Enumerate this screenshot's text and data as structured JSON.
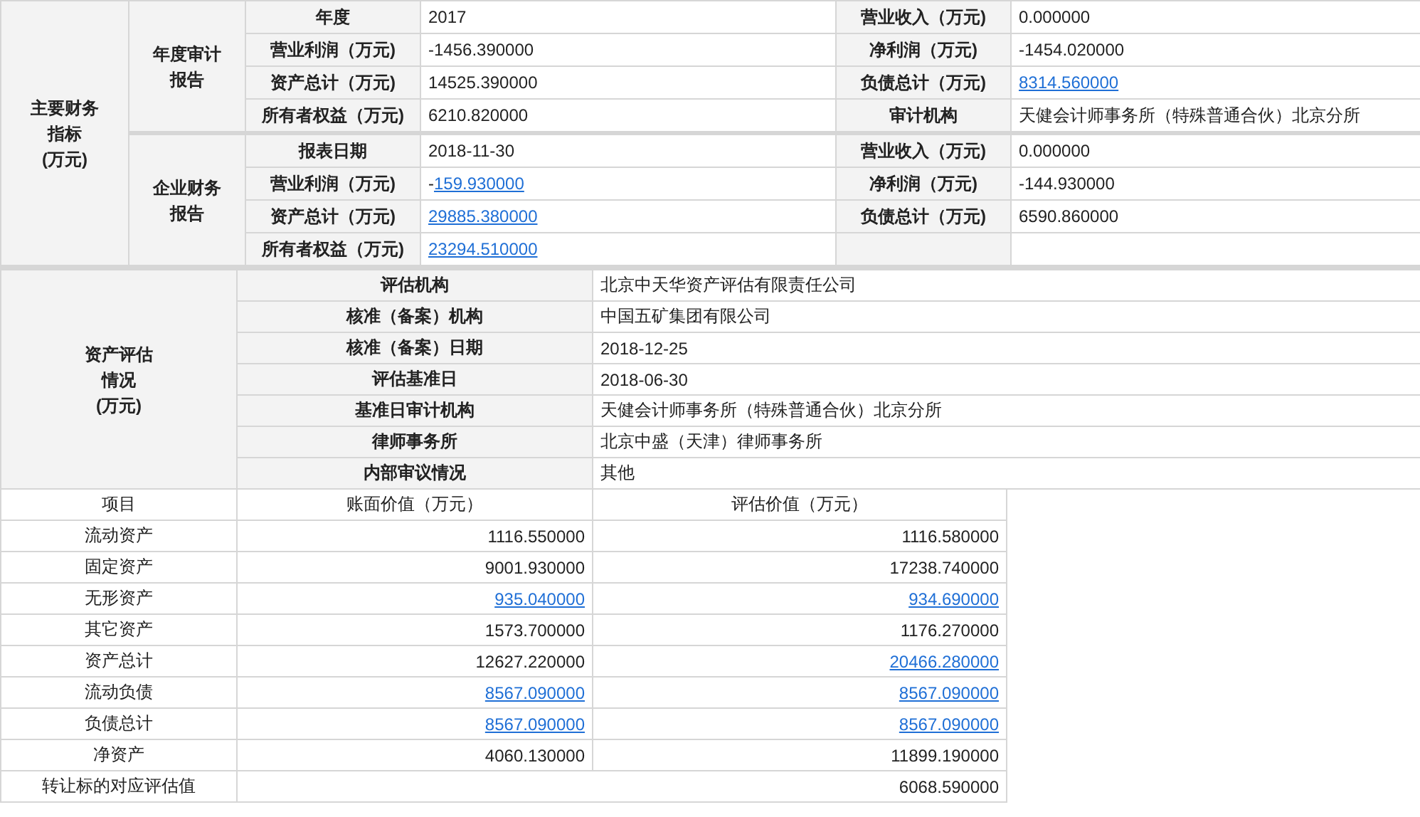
{
  "financial": {
    "title_lines": [
      "主要财务",
      "指标",
      "(万元)"
    ],
    "groups": [
      {
        "title_lines": [
          "年度审计",
          "报告"
        ],
        "rows": [
          [
            {
              "label": "年度",
              "value": {
                "plain": "2017"
              }
            },
            {
              "label": "营业收入（万元)",
              "value": {
                "plain": "0.000000"
              }
            }
          ],
          [
            {
              "label": "营业利润（万元)",
              "value": {
                "plain": "-1456.390000"
              }
            },
            {
              "label": "净利润（万元)",
              "value": {
                "plain": "-1454.020000"
              }
            }
          ],
          [
            {
              "label": "资产总计（万元)",
              "value": {
                "plain": "14525.390000"
              }
            },
            {
              "label": "负债总计（万元)",
              "value": {
                "link": "8314.560000"
              }
            }
          ],
          [
            {
              "label": "所有者权益（万元)",
              "value": {
                "plain": "6210.820000"
              }
            },
            {
              "label": "审计机构",
              "value": {
                "plain": "天健会计师事务所（特殊普通合伙）北京分所"
              }
            }
          ]
        ]
      },
      {
        "title_lines": [
          "企业财务",
          "报告"
        ],
        "rows": [
          [
            {
              "label": "报表日期",
              "value": {
                "plain": "2018-11-30"
              }
            },
            {
              "label": "营业收入（万元)",
              "value": {
                "plain": "0.000000"
              }
            }
          ],
          [
            {
              "label": "营业利润（万元)",
              "value": {
                "plain": "-",
                "link": "159.930000"
              }
            },
            {
              "label": "净利润（万元)",
              "value": {
                "plain": "-144.930000"
              }
            }
          ],
          [
            {
              "label": "资产总计（万元)",
              "value": {
                "link": "29885.380000"
              }
            },
            {
              "label": "负债总计（万元)",
              "value": {
                "plain": "6590.860000"
              }
            }
          ],
          [
            {
              "label": "所有者权益（万元)",
              "value": {
                "link": "23294.510000"
              }
            }
          ]
        ]
      }
    ]
  },
  "assessment": {
    "title_lines": [
      "资产评估",
      "情况",
      "(万元)"
    ],
    "info": [
      {
        "label": "评估机构",
        "value": {
          "plain": "北京中天华资产评估有限责任公司"
        }
      },
      {
        "label": "核准（备案）机构",
        "value": {
          "plain": "中国五矿集团有限公司"
        }
      },
      {
        "label": "核准（备案）日期",
        "value": {
          "plain": "2018-12-25"
        }
      },
      {
        "label": "评估基准日",
        "value": {
          "plain": "2018-06-30"
        }
      },
      {
        "label": "基准日审计机构",
        "value": {
          "plain": "天健会计师事务所（特殊普通合伙）北京分所"
        }
      },
      {
        "label": "律师事务所",
        "value": {
          "plain": "北京中盛（天津）律师事务所"
        }
      },
      {
        "label": "内部审议情况",
        "value": {
          "plain": "其他"
        }
      }
    ],
    "columns": [
      "项目",
      "账面价值（万元）",
      "评估价值（万元）"
    ],
    "rows": [
      {
        "item": "流动资产",
        "book": {
          "plain": "1116.550000"
        },
        "appraised": {
          "plain": "1116.580000"
        }
      },
      {
        "item": "固定资产",
        "book": {
          "plain": "9001.930000"
        },
        "appraised": {
          "plain": "17238.740000"
        }
      },
      {
        "item": "无形资产",
        "book": {
          "link": "935.040000"
        },
        "appraised": {
          "link": "934.690000"
        }
      },
      {
        "item": "其它资产",
        "book": {
          "plain": "1573.700000"
        },
        "appraised": {
          "plain": "1176.270000"
        }
      },
      {
        "item": "资产总计",
        "book": {
          "plain": "12627.220000"
        },
        "appraised": {
          "link": "20466.280000"
        }
      },
      {
        "item": "流动负债",
        "book": {
          "link": "8567.090000"
        },
        "appraised": {
          "link": "8567.090000"
        }
      },
      {
        "item": "负债总计",
        "book": {
          "link": "8567.090000"
        },
        "appraised": {
          "link": "8567.090000"
        }
      },
      {
        "item": "净资产",
        "book": {
          "plain": "4060.130000"
        },
        "appraised": {
          "plain": "11899.190000"
        }
      }
    ],
    "total": {
      "label": "转让标的对应评估值",
      "value": {
        "plain": "6068.590000"
      }
    }
  }
}
